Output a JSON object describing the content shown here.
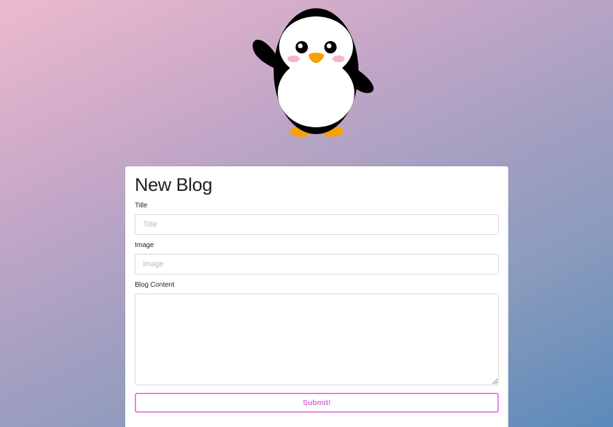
{
  "mascot": {
    "icon": "penguin-icon",
    "colors": {
      "body": "#000000",
      "belly": "#ffffff",
      "beak": "#f5a10c",
      "feet": "#f5a10c",
      "cheeks": "#f6b8cb"
    }
  },
  "form": {
    "title": "New Blog",
    "fields": {
      "title": {
        "label": "Title",
        "placeholder": "Title",
        "value": ""
      },
      "image": {
        "label": "Image",
        "placeholder": "image",
        "value": ""
      },
      "content": {
        "label": "Blog Content",
        "value": ""
      }
    },
    "submit_label": "Submit!",
    "accent_color": "#e37fe8"
  }
}
